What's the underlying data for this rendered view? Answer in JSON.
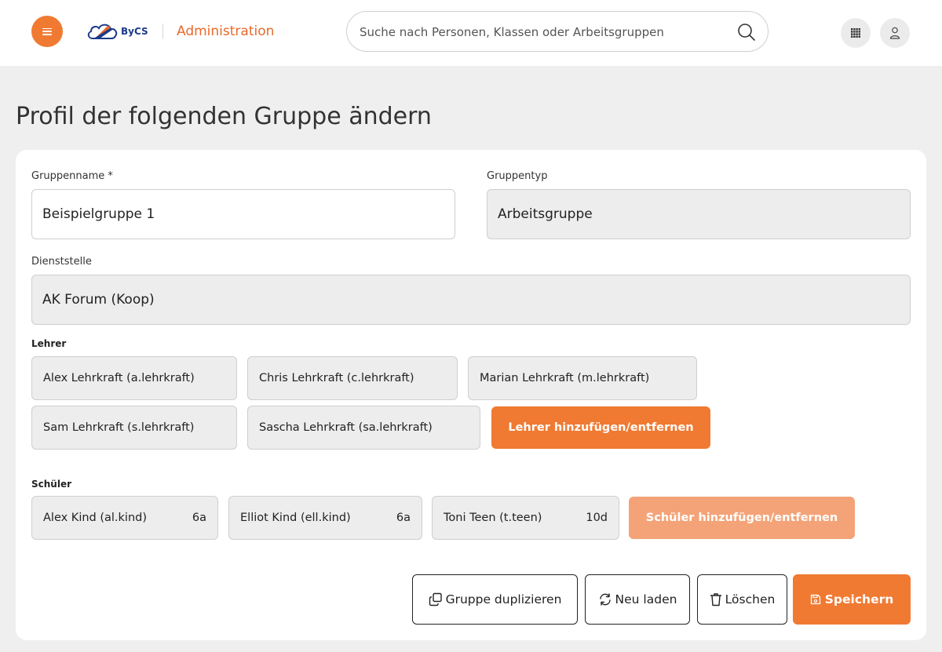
{
  "header": {
    "menu_icon": "hamburger-icon",
    "logo_text": "ByCS",
    "app_title": "Administration",
    "search_placeholder": "Suche nach Personen, Klassen oder Arbeitsgruppen",
    "apps_icon": "grid-icon",
    "profile_icon": "user-icon",
    "accent_color": "#f07a32"
  },
  "page": {
    "title": "Profil der folgenden Gruppe ändern"
  },
  "form": {
    "group_name_label": "Gruppenname *",
    "group_name_value": "Beispielgruppe 1",
    "group_type_label": "Gruppentyp",
    "group_type_value": "Arbeitsgruppe",
    "office_label": "Dienststelle",
    "office_value": "AK Forum (Koop)"
  },
  "teachers": {
    "label": "Lehrer",
    "items": [
      "Alex Lehrkraft (a.lehrkraft)",
      "Chris Lehrkraft (c.lehrkraft)",
      "Marian Lehrkraft (m.lehrkraft)",
      "Sam Lehrkraft (s.lehrkraft)",
      "Sascha Lehrkraft (sa.lehrkraft)"
    ],
    "manage_label": "Lehrer hinzufügen/entfernen"
  },
  "students": {
    "label": "Schüler",
    "items": [
      {
        "name": "Alex Kind (al.kind)",
        "class": "6a"
      },
      {
        "name": "Elliot Kind (ell.kind)",
        "class": "6a"
      },
      {
        "name": "Toni Teen (t.teen)",
        "class": "10d"
      }
    ],
    "manage_label": "Schüler hinzufügen/entfernen"
  },
  "actions": {
    "duplicate_label": "Gruppe duplizieren",
    "reload_label": "Neu laden",
    "delete_label": "Löschen",
    "save_label": "Speichern"
  }
}
